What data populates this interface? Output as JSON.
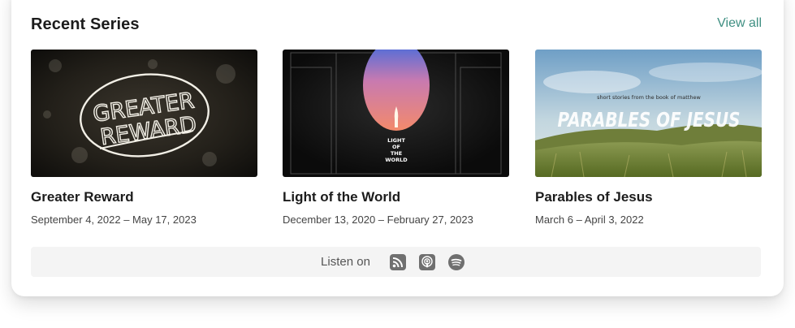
{
  "header": {
    "title": "Recent Series",
    "view_all_label": "View all"
  },
  "series": [
    {
      "title": "Greater Reward",
      "dates": "September 4, 2022 – May 17, 2023",
      "artwork_text": [
        "GREATER",
        "REWARD"
      ]
    },
    {
      "title": "Light of the World",
      "dates": "December 13, 2020 – February 27, 2023",
      "artwork_text": [
        "LIGHT",
        "OF",
        "THE",
        "WORLD"
      ]
    },
    {
      "title": "Parables of Jesus",
      "dates": "March 6 – April 3, 2022",
      "artwork_subtitle": "short stories from the book of matthew",
      "artwork_title": "PARABLES OF JESUS"
    }
  ],
  "listen": {
    "label": "Listen on",
    "platforms": [
      {
        "name": "RSS",
        "icon": "rss-icon"
      },
      {
        "name": "Apple Podcasts",
        "icon": "apple-podcasts-icon"
      },
      {
        "name": "Spotify",
        "icon": "spotify-icon"
      }
    ]
  },
  "colors": {
    "accent": "#3f8f82",
    "listen_bar_bg": "#f4f4f4",
    "icon_gray": "#6f6f6f"
  }
}
